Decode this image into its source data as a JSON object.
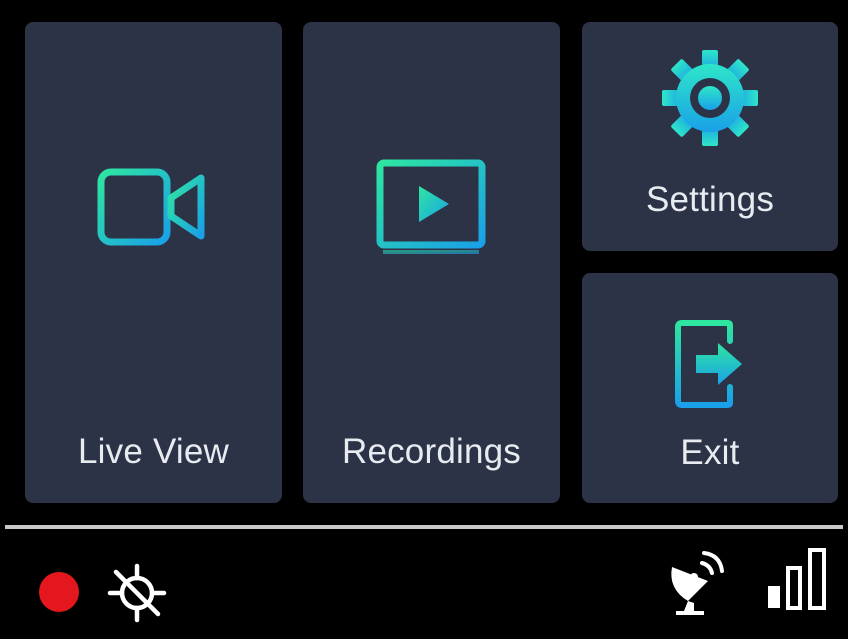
{
  "tiles": {
    "live_view": {
      "label": "Live View",
      "icon": "video-camera-icon"
    },
    "recordings": {
      "label": "Recordings",
      "icon": "play-screen-icon"
    },
    "settings": {
      "label": "Settings",
      "icon": "gear-icon"
    },
    "exit": {
      "label": "Exit",
      "icon": "exit-door-icon"
    }
  },
  "status_bar": {
    "recording_indicator": "recording-dot-icon",
    "gps_icon": "gps-off-icon",
    "satellite_icon": "satellite-dish-icon",
    "signal_icon": "signal-strength-icon",
    "signal_level": 0.33
  },
  "colors": {
    "tile_background": "#2c3347",
    "accent_start": "#2ee6a0",
    "accent_end": "#1aa0e8",
    "recording_red": "#e3171d",
    "label_text": "#e8ebf0"
  }
}
